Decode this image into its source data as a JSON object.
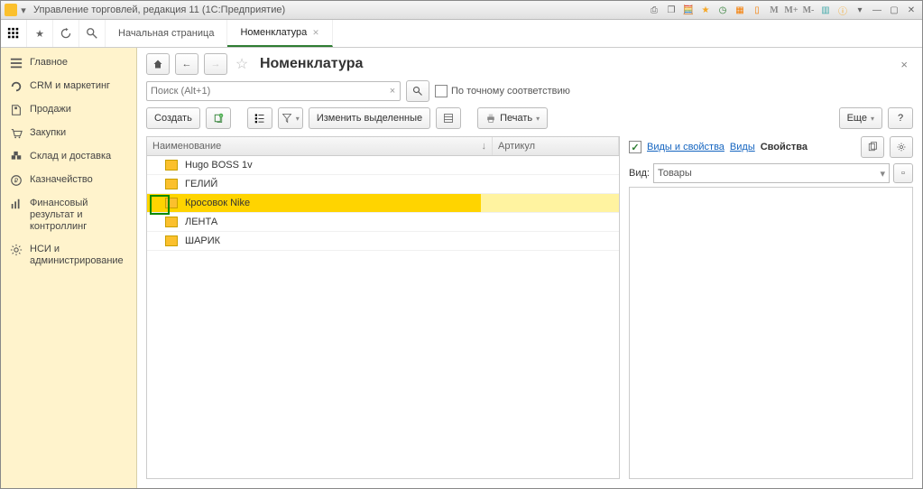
{
  "titlebar": {
    "title": "Управление торговлей, редакция 11   (1С:Предприятие)"
  },
  "tabs": {
    "start": "Начальная страница",
    "nomen": "Номенклатура"
  },
  "sidebar": {
    "items": [
      {
        "label": "Главное"
      },
      {
        "label": "CRM и маркетинг"
      },
      {
        "label": "Продажи"
      },
      {
        "label": "Закупки"
      },
      {
        "label": "Склад и доставка"
      },
      {
        "label": "Казначейство"
      },
      {
        "label": "Финансовый результат и контроллинг"
      },
      {
        "label": "НСИ и администрирование"
      }
    ]
  },
  "page": {
    "title": "Номенклатура"
  },
  "search": {
    "placeholder": "Поиск (Alt+1)",
    "exact_label": "По точному соответствию"
  },
  "rightlinks": {
    "types_props": "Виды и свойства",
    "types": "Виды",
    "props": "Свойства"
  },
  "toolbar": {
    "create": "Создать",
    "change_sel": "Изменить выделенные",
    "print": "Печать",
    "more": "Еще"
  },
  "right": {
    "vid_label": "Вид:",
    "vid_value": "Товары"
  },
  "columns": {
    "name": "Наименование",
    "sort": "↓",
    "art": "Артикул"
  },
  "rows": [
    {
      "label": "Hugo BOSS 1v"
    },
    {
      "label": "ГЕЛИЙ"
    },
    {
      "label": "Кросовок Nike",
      "selected": true
    },
    {
      "label": "ЛЕНТА"
    },
    {
      "label": "ШАРИК"
    }
  ]
}
